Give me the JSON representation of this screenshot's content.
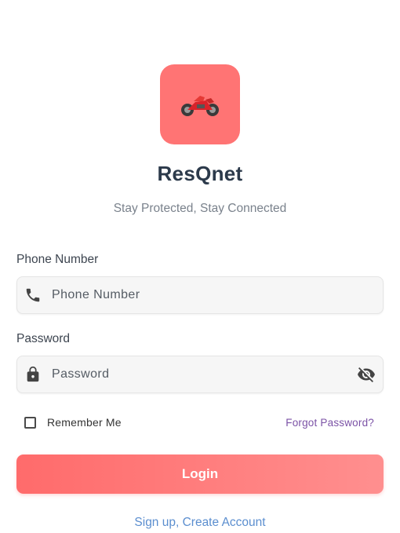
{
  "app": {
    "title": "ResQnet",
    "tagline": "Stay Protected, Stay Connected",
    "logo_icon": "motorcycle-icon",
    "accent_color": "#ff7474"
  },
  "form": {
    "phone": {
      "label": "Phone Number",
      "placeholder": "Phone Number",
      "value": "",
      "icon": "phone-icon"
    },
    "password": {
      "label": "Password",
      "placeholder": "Password",
      "value": "",
      "icon": "lock-icon",
      "toggle_icon": "visibility-off-icon"
    },
    "remember_me": {
      "label": "Remember Me",
      "checked": false
    },
    "forgot_password": "Forgot Password?",
    "login_button": "Login",
    "signup_link": "Sign up, Create Account"
  }
}
